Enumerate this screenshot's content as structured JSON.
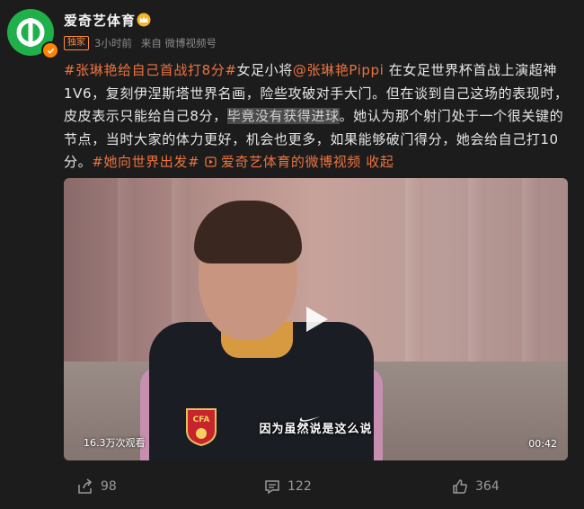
{
  "author": {
    "name": "爱奇艺体育",
    "verified_color": "#ff8200",
    "avatar_color": "#1fb04b",
    "badge": "独家",
    "time": "3小时前",
    "source": "来自 微博视频号"
  },
  "post": {
    "tag1": "#张琳艳给自己首战打8分#",
    "t1": "女足小将",
    "mention": "@张琳艳Pippi",
    "t2": " 在女足世界杯首战上演超神1V6，复刻伊涅斯塔世界名画，险些攻破对手大门。但在谈到自己这场的表现时，皮皮表示只能给自己8分，",
    "highlight": "毕竟没有获得进球",
    "t3": "。她认为那个射门处于一个很关键的节点，当时大家的体力更好，机会也更多，如果能够破门得分，她会给自己打10分。",
    "tag2": "#她向世界出发#",
    "video_link": "爱奇艺体育的微博视频",
    "collapse": "收起"
  },
  "video": {
    "subtitle": "因为虽然说是这么说",
    "views": "16.3万次观看",
    "duration": "00:42",
    "crest_text": "CFA"
  },
  "actions": {
    "share_count": "98",
    "comment_count": "122",
    "like_count": "364"
  }
}
